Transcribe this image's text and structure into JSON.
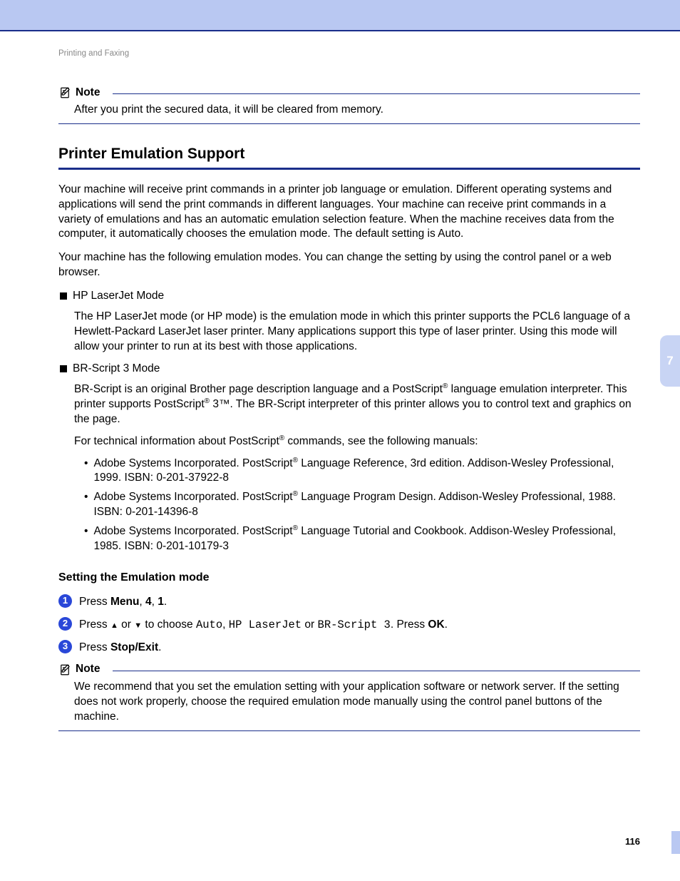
{
  "breadcrumb": "Printing and Faxing",
  "note1": {
    "label": "Note",
    "body": "After you print the secured data, it will be cleared from memory."
  },
  "section": {
    "title": "Printer Emulation Support",
    "p1": "Your machine will receive print commands in a printer job language or emulation. Different operating systems and applications will send the print commands in different languages. Your machine can receive print commands in a variety of emulations and has an automatic emulation selection feature. When the machine receives data from the computer, it automatically chooses the emulation mode. The default setting is Auto.",
    "p2": "Your machine has the following emulation modes. You can change the setting by using the control panel or a web browser.",
    "mode1": {
      "name": "HP LaserJet Mode",
      "desc": "The HP LaserJet mode (or HP mode) is the emulation mode in which this printer supports the PCL6 language of a Hewlett-Packard LaserJet laser printer. Many applications support this type of laser printer. Using this mode will allow your printer to run at its best with those applications."
    },
    "mode2": {
      "name": "BR-Script 3 Mode",
      "desc_a": "BR-Script is an original Brother page description language and a PostScript",
      "desc_b": " language emulation interpreter. This printer supports PostScript",
      "desc_c": " 3™. The BR-Script interpreter of this printer allows you to control text and graphics on the page.",
      "tech_a": "For technical information about PostScript",
      "tech_b": " commands, see the following manuals:",
      "ref1_a": "Adobe Systems Incorporated. PostScript",
      "ref1_b": " Language Reference, 3rd edition. Addison-Wesley Professional, 1999. ISBN: 0-201-37922-8",
      "ref2_a": "Adobe Systems Incorporated. PostScript",
      "ref2_b": " Language Program Design. Addison-Wesley Professional, 1988. ISBN: 0-201-14396-8",
      "ref3_a": "Adobe Systems Incorporated. PostScript",
      "ref3_b": " Language Tutorial and Cookbook. Addison-Wesley Professional, 1985. ISBN: 0-201-10179-3"
    }
  },
  "setting": {
    "heading": "Setting the Emulation mode",
    "s1_a": "Press ",
    "s1_menu": "Menu",
    "s1_b": ", ",
    "s1_4": "4",
    "s1_c": ", ",
    "s1_1": "1",
    "s1_d": ".",
    "s2_a": "Press ",
    "s2_b": " or ",
    "s2_c": " to choose ",
    "s2_auto": "Auto",
    "s2_d": ", ",
    "s2_hp": "HP LaserJet",
    "s2_e": " or ",
    "s2_br": "BR-Script 3",
    "s2_f": ". Press ",
    "s2_ok": "OK",
    "s2_g": ".",
    "s3_a": "Press ",
    "s3_stop": "Stop/Exit",
    "s3_b": "."
  },
  "note2": {
    "label": "Note",
    "body": "We recommend that you set the emulation setting with your application software or network server. If the setting does not work properly, choose the required emulation mode manually using the control panel buttons of the machine."
  },
  "side_tab": "7",
  "page_number": "116"
}
